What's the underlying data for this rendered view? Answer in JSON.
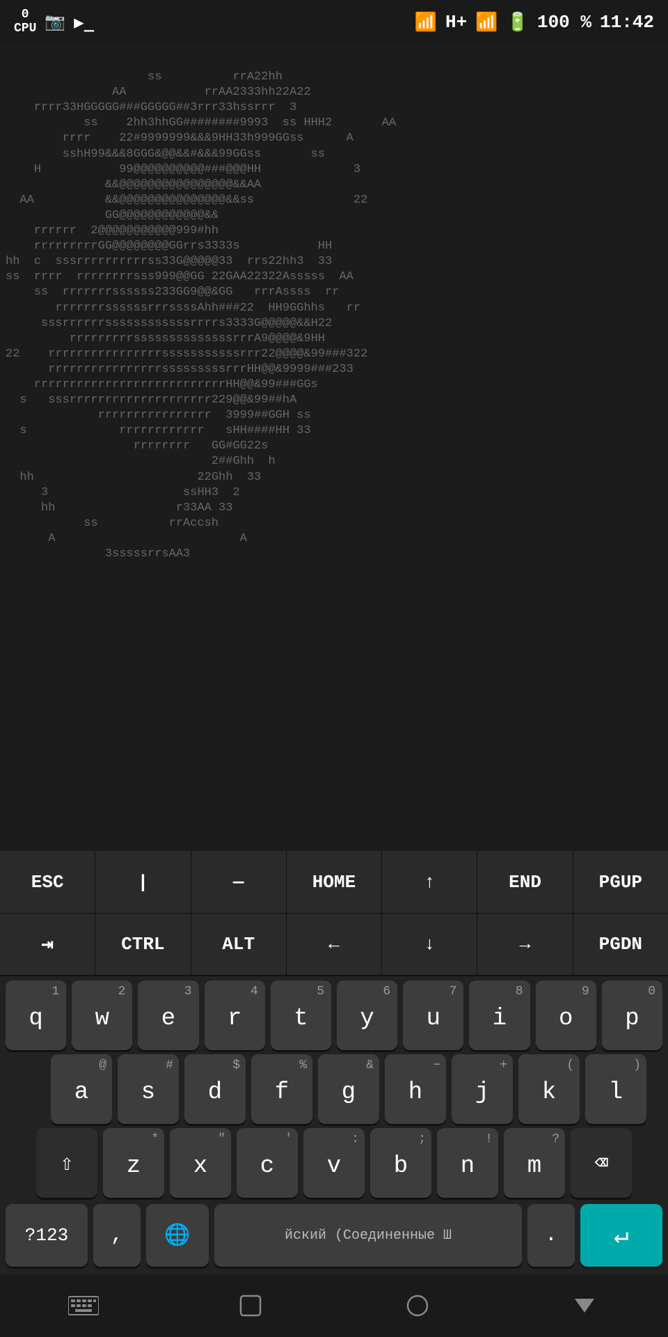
{
  "statusBar": {
    "cpu": "0\nCPU",
    "cpuNum": "0",
    "cpuLabel": "CPU",
    "battery": "100 %",
    "time": "11:42",
    "signal": "H+"
  },
  "terminal": {
    "lines": [
      "                    ss          rrA22hh",
      "               AA           rrAA2333hh22A22",
      "    rrrr33HGGGGG###GGGGG##3rrr33hssrrr  3",
      "           ss    2hh3hhGG########9993  ss HHH2       AA",
      "        rrrr    22#9999999&&&9HH33h999GGss      A",
      "        sshH99&&&8GGG&@@&&#&&&99GGss       ss",
      "    H           99@@@@@@@@@@###@@@HH             3",
      "              &&@@@@@@@@@@@@@@@@&&AA",
      "  AA          &&@@@@@@@@@@@@@@@&&ss              22",
      "              GG@@@@@@@@@@@@&&",
      "    rrrrrr  2@@@@@@@@@@@999#hh",
      "    rrrrrrrrrGG@@@@@@@@GGrrs3333s           HH",
      "hh  c  sssrrrrrrrrrrss33G@@@@@33  rrs22hh3  33",
      "ss  rrrr  rrrrrrrrsss999@@GG 22GAA22322Asssss  AA",
      "    ss  rrrrrrrssssss233GG9@@&GG   rrrAssss  rr",
      "       rrrrrrrssssssrrrssssAhh###22  HH9GGhhs   rr",
      "     sssrrrrrrssssssssssssrrrrs3333G@@@@@&&H22",
      "         rrrrrrrrrssssssssssssssrrrA9@@@@&9HH",
      "22    rrrrrrrrrrrrrrrrsssssssssssrrr22@@@@&99###322",
      "      rrrrrrrrrrrrrrrrsssssssssrrrHH@@&9999###233",
      "    rrrrrrrrrrrrrrrrrrrrrrrrrrrHH@@&99###GGs",
      "  s   sssrrrrrrrrrrrrrrrrrrrr229@@&99##hA",
      "             rrrrrrrrrrrrrrrr  3999##GGH ss",
      "  s             rrrrrrrrrrrr   sHH####HH 33",
      "                  rrrrrrrr   GG#GG22s",
      "                             2##Ghh  h",
      "  hh                       22Ghh  33",
      "     3                   ssHH3  2",
      "     hh                 r33AA 33",
      "           ss          rrAccsh",
      "      A                          A",
      "              3sssssrrsAA3"
    ]
  },
  "specialRow1": {
    "keys": [
      "ESC",
      "|",
      "—",
      "HOME",
      "↑",
      "END",
      "PGUP"
    ]
  },
  "specialRow2": {
    "keys": [
      "⇥",
      "CTRL",
      "ALT",
      "←",
      "↓",
      "→",
      "PGDN"
    ]
  },
  "keyboardRow1": {
    "keys": [
      {
        "num": "1",
        "letter": "q"
      },
      {
        "num": "2",
        "letter": "w"
      },
      {
        "num": "3",
        "letter": "e"
      },
      {
        "num": "4",
        "letter": "r"
      },
      {
        "num": "5",
        "letter": "t"
      },
      {
        "num": "6",
        "letter": "y"
      },
      {
        "num": "7",
        "letter": "u"
      },
      {
        "num": "8",
        "letter": "i"
      },
      {
        "num": "9",
        "letter": "o"
      },
      {
        "num": "0",
        "letter": "p"
      }
    ]
  },
  "keyboardRow2": {
    "keys": [
      {
        "sym": "@",
        "letter": "a"
      },
      {
        "sym": "#",
        "letter": "s"
      },
      {
        "sym": "$",
        "letter": "d"
      },
      {
        "sym": "%",
        "letter": "f"
      },
      {
        "sym": "&",
        "letter": "g"
      },
      {
        "sym": "−",
        "letter": "h"
      },
      {
        "sym": "+",
        "letter": "j"
      },
      {
        "sym": "(",
        "letter": "k"
      },
      {
        "sym": ")",
        "letter": "l"
      }
    ]
  },
  "keyboardRow3": {
    "keys": [
      {
        "sym": "*",
        "letter": "z"
      },
      {
        "sym": "\"",
        "letter": "x"
      },
      {
        "sym": "'",
        "letter": "c"
      },
      {
        "sym": ":",
        "letter": "v"
      },
      {
        "sym": ";",
        "letter": "b"
      },
      {
        "sym": "!",
        "letter": "n"
      },
      {
        "sym": "?",
        "letter": "m"
      }
    ]
  },
  "keyboardRow4": {
    "numLabel": "?123",
    "commaLabel": ",",
    "spaceLabel": "йский (Соединенные Ш",
    "periodLabel": ".",
    "enterLabel": "↵"
  },
  "navbar": {
    "keyboardIcon": "⬛",
    "squareIcon": "□",
    "circleIcon": "○",
    "triangleIcon": "▼"
  }
}
